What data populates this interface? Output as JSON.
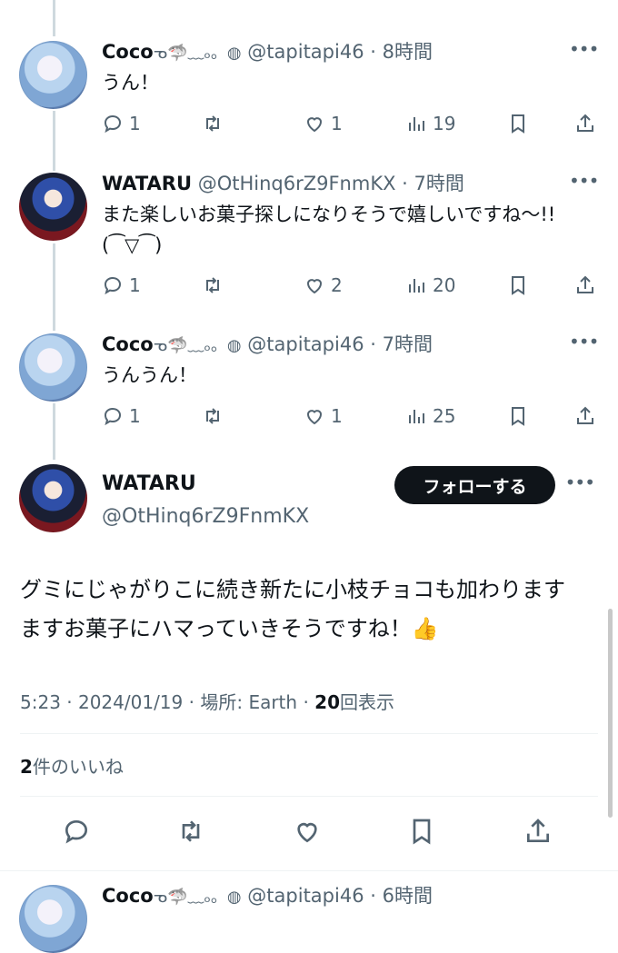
{
  "replies": [
    {
      "avatar": "coco-avatar",
      "name": "Coco",
      "name_deco": "ᓀ🦈﹏ₒ。◍",
      "handle": "@tapitapi46",
      "time": "8時間",
      "text": "うん！",
      "actions": {
        "reply": "1",
        "retweet": "",
        "like": "1",
        "views": "19"
      }
    },
    {
      "avatar": "wataru-avatar",
      "name": "WATARU",
      "name_deco": "",
      "handle": "@OtHinq6rZ9FnmKX",
      "time": "7時間",
      "text": "また楽しいお菓子探しになりそうで嬉しいですね〜!!(⁀▽⁀)",
      "actions": {
        "reply": "1",
        "retweet": "",
        "like": "2",
        "views": "20"
      }
    },
    {
      "avatar": "coco-avatar",
      "name": "Coco",
      "name_deco": "ᓀ🦈﹏ₒ。◍",
      "handle": "@tapitapi46",
      "time": "7時間",
      "text": "うんうん！",
      "actions": {
        "reply": "1",
        "retweet": "",
        "like": "1",
        "views": "25"
      }
    }
  ],
  "main": {
    "name": "WATARU",
    "handle": "@OtHinq6rZ9FnmKX",
    "follow_label": "フォローする",
    "text": "グミにじゃがりこに続き新たに小枝チョコも加わりますますお菓子にハマっていきそうですね！👍",
    "time": "5:23 · 2024/01/19",
    "location": "場所: Earth",
    "views_count": "20",
    "views_label": "回表示",
    "likes_count": "2",
    "likes_label": "件のいいね"
  },
  "next_reply": {
    "name": "Coco",
    "name_deco": "ᓀ🦈﹏ₒ。◍",
    "handle": "@tapitapi46",
    "time": "6時間"
  },
  "separator": "·",
  "more_glyph": "•••",
  "colors": {
    "text": "#0f1419",
    "secondary": "#536471",
    "follow_bg": "#0f1419",
    "divider": "#eff3f4"
  },
  "icons": [
    "reply-icon",
    "retweet-icon",
    "like-icon",
    "views-icon",
    "bookmark-icon",
    "share-icon"
  ]
}
